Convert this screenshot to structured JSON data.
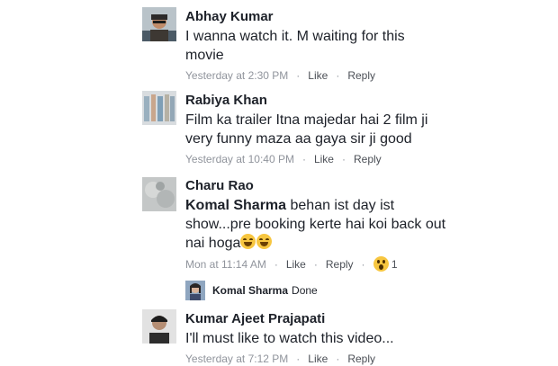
{
  "comments": [
    {
      "author": "Abhay Kumar",
      "text": "I wanna watch it. M waiting for this movie",
      "time": "Yesterday at 2:30 PM",
      "like": "Like",
      "reply": "Reply"
    },
    {
      "author": "Rabiya Khan",
      "text": "Film ka trailer Itna majedar hai 2 film ji very funny maza aa gaya sir ji good",
      "time": "Yesterday at 10:40 PM",
      "like": "Like",
      "reply": "Reply"
    },
    {
      "author": "Charu Rao",
      "mention": "Komal Sharma",
      "text": " behan ist day ist show...pre booking kerte hai koi back out nai hoga",
      "time": "Mon at 11:14 AM",
      "like": "Like",
      "reply": "Reply",
      "reaction_icon": "wow-reaction-icon",
      "reaction_count": "1"
    },
    {
      "author": "Kumar Ajeet Prajapati",
      "text": "I'll must like to watch this video...",
      "time": "Yesterday at 7:12 PM",
      "like": "Like",
      "reply": "Reply"
    }
  ],
  "reply_preview": {
    "author": "Komal Sharma",
    "text": "Done"
  },
  "separator": "·",
  "colors": {
    "meta": "#90949c",
    "action": "#4b4f56",
    "text": "#1d2129"
  }
}
